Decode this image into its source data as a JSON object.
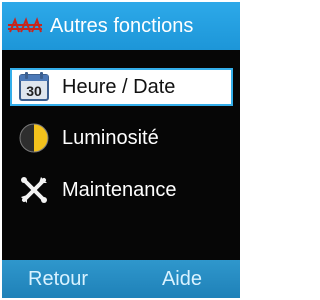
{
  "header": {
    "title": "Autres fonctions",
    "logo_icon": "brand-logo-icon"
  },
  "menu": {
    "items": [
      {
        "label": "Heure / Date",
        "icon": "calendar-icon",
        "icon_text": "30",
        "selected": true
      },
      {
        "label": "Luminosité",
        "icon": "brightness-icon",
        "selected": false
      },
      {
        "label": "Maintenance",
        "icon": "tools-icon",
        "selected": false
      }
    ]
  },
  "footer": {
    "left_label": "Retour",
    "right_label": "Aide"
  },
  "colors": {
    "header": "#23A0E3",
    "footer": "#2588BF",
    "screen_background": "#060606",
    "selection": "#FFFFFF",
    "selection_border": "#34AEEA"
  }
}
